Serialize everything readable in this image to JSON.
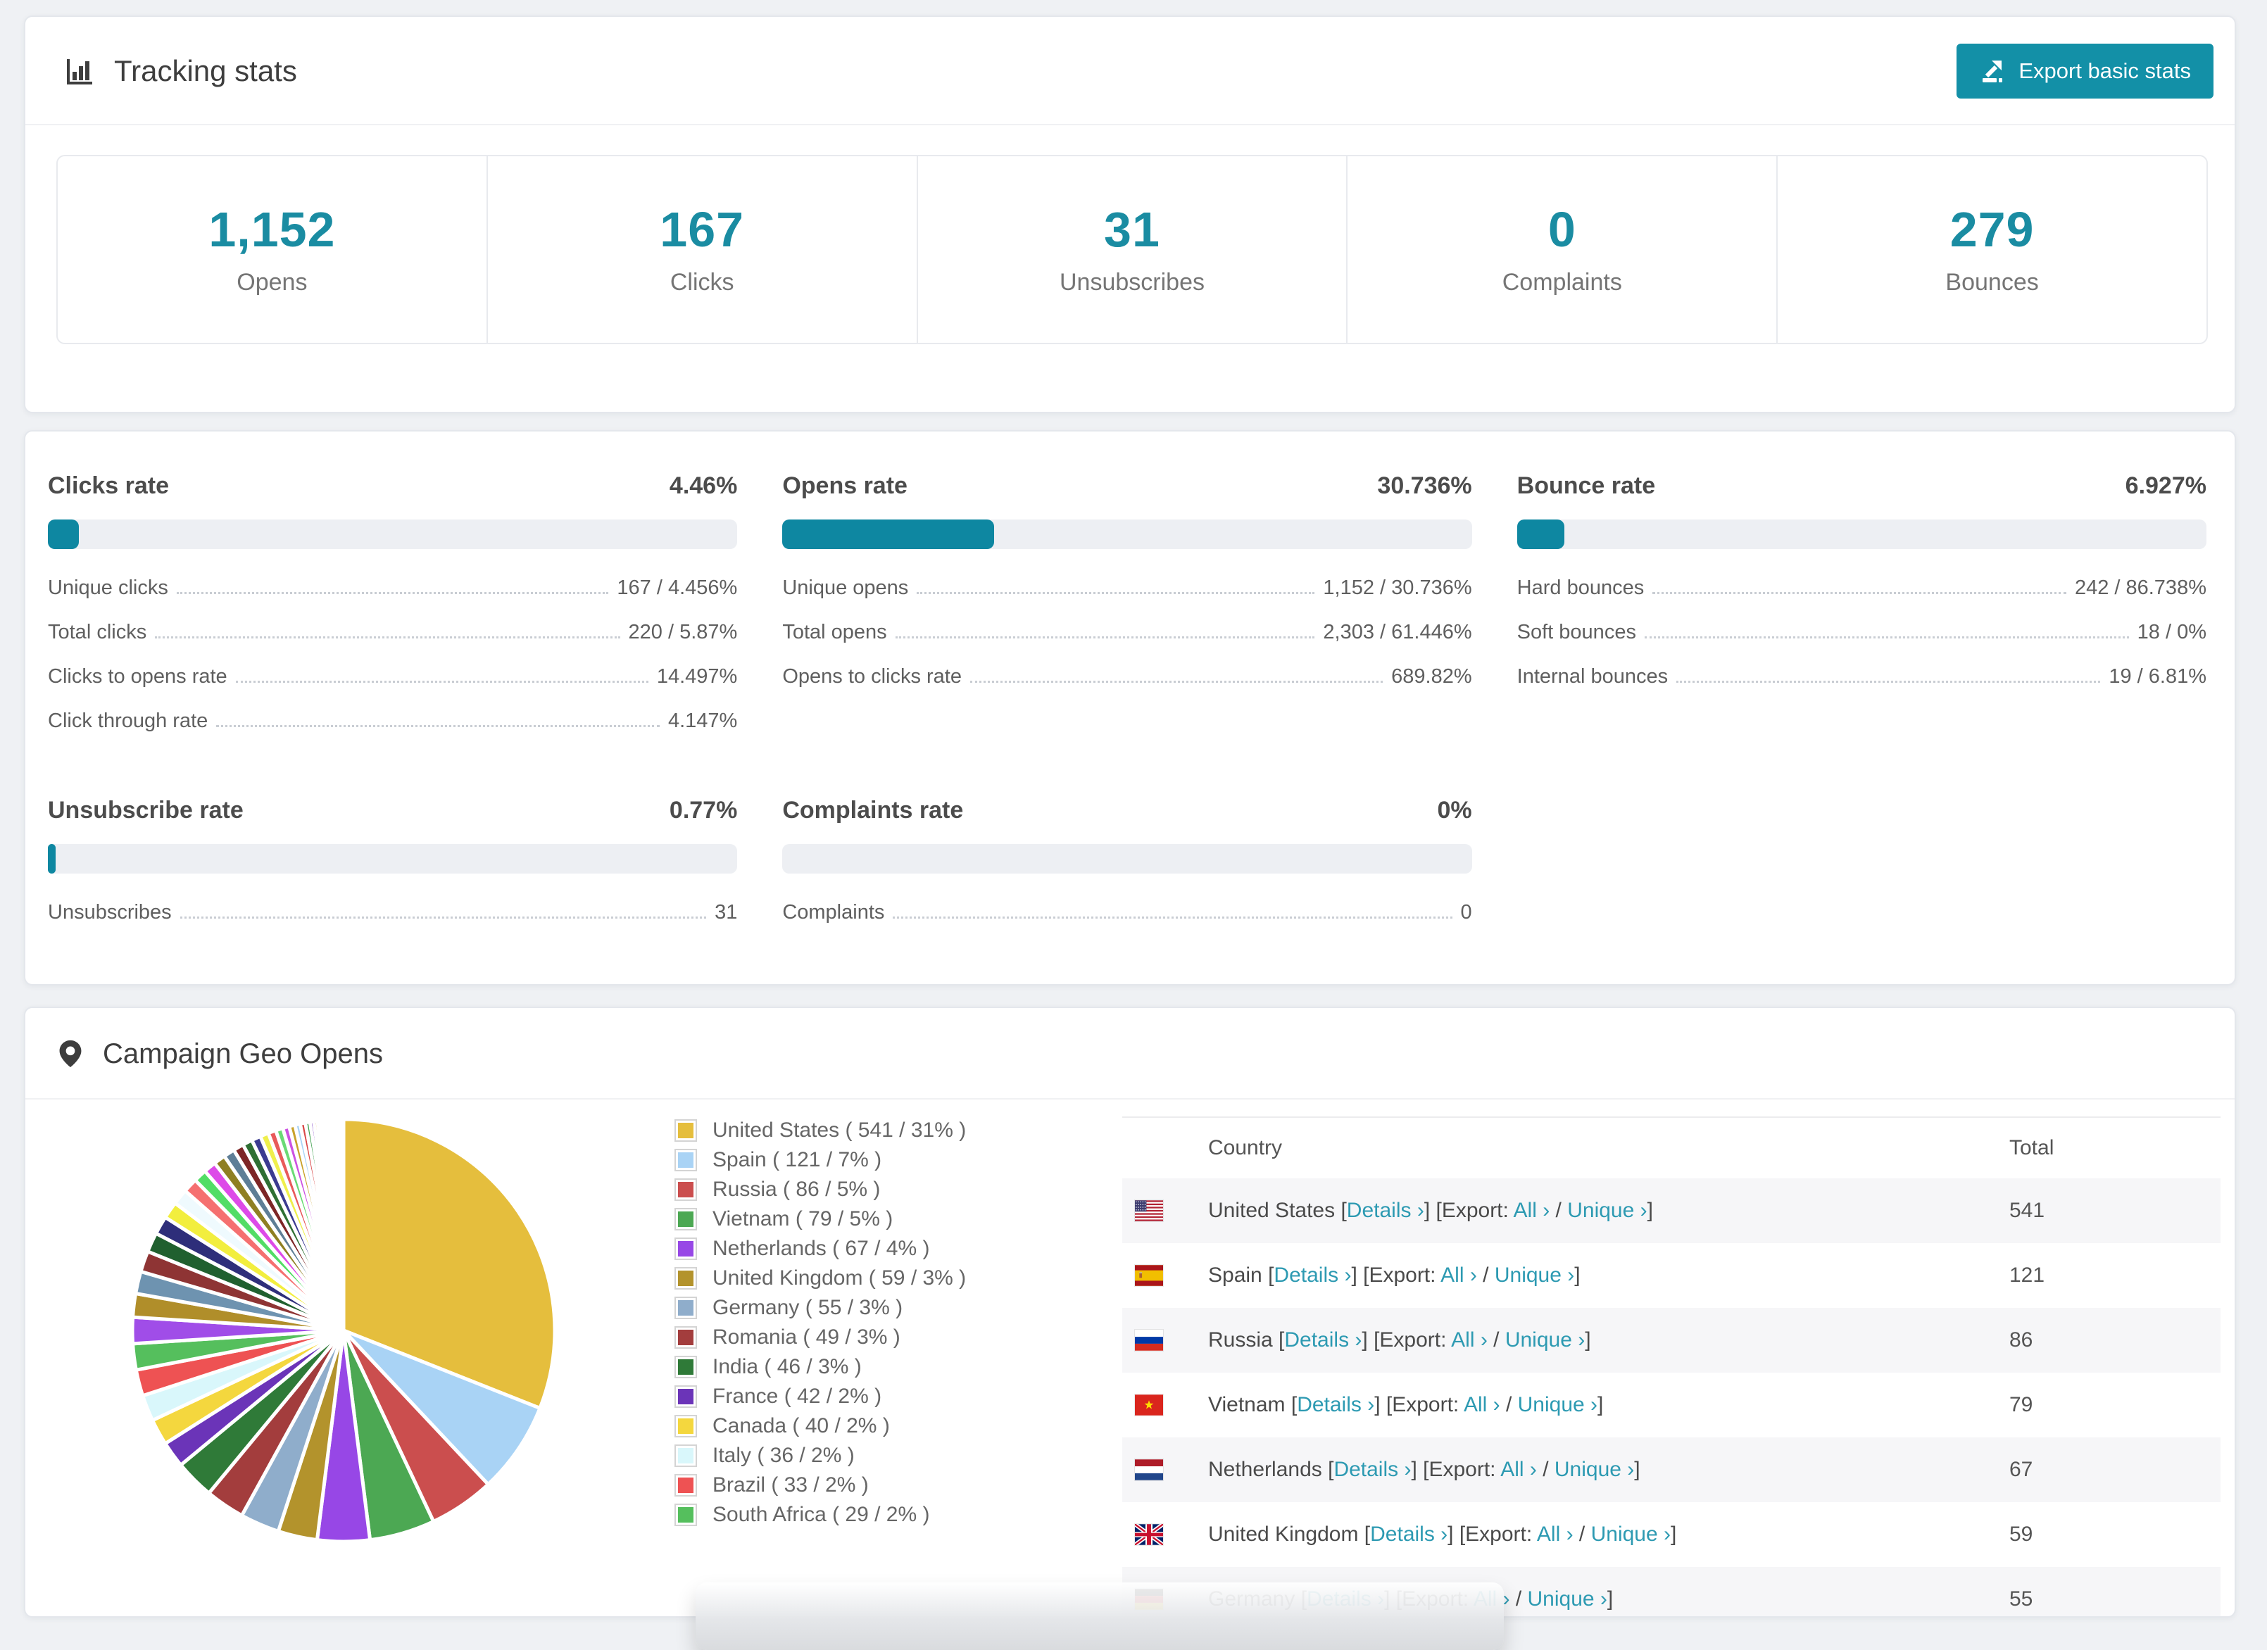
{
  "colors": {
    "accent_teal": "#1390A7",
    "bar_fill": "#0E87A1",
    "stat_number": "#1A8CA2",
    "link": "#2D9AB2",
    "page_background": "#EFF1F4"
  },
  "tracking": {
    "title": "Tracking stats",
    "export_button": "Export basic stats"
  },
  "summary_stats": [
    {
      "value": "1,152",
      "label": "Opens"
    },
    {
      "value": "167",
      "label": "Clicks"
    },
    {
      "value": "31",
      "label": "Unsubscribes"
    },
    {
      "value": "0",
      "label": "Complaints"
    },
    {
      "value": "279",
      "label": "Bounces"
    }
  ],
  "rate_blocks": [
    {
      "title": "Clicks rate",
      "value": "4.46%",
      "percent": 4.46,
      "rows": [
        {
          "label": "Unique clicks",
          "value": "167 / 4.456%"
        },
        {
          "label": "Total clicks",
          "value": "220 / 5.87%"
        },
        {
          "label": "Clicks to opens rate",
          "value": "14.497%"
        },
        {
          "label": "Click through rate",
          "value": "4.147%"
        }
      ]
    },
    {
      "title": "Opens rate",
      "value": "30.736%",
      "percent": 30.736,
      "rows": [
        {
          "label": "Unique opens",
          "value": "1,152 / 30.736%"
        },
        {
          "label": "Total opens",
          "value": "2,303 / 61.446%"
        },
        {
          "label": "Opens to clicks rate",
          "value": "689.82%"
        }
      ]
    },
    {
      "title": "Bounce rate",
      "value": "6.927%",
      "percent": 6.927,
      "rows": [
        {
          "label": "Hard bounces",
          "value": "242 / 86.738%"
        },
        {
          "label": "Soft bounces",
          "value": "18 / 0%"
        },
        {
          "label": "Internal bounces",
          "value": "19 / 6.81%"
        }
      ]
    },
    {
      "title": "Unsubscribe rate",
      "value": "0.77%",
      "percent": 0.77,
      "rows": [
        {
          "label": "Unsubscribes",
          "value": "31"
        }
      ]
    },
    {
      "title": "Complaints rate",
      "value": "0%",
      "percent": 0,
      "rows": [
        {
          "label": "Complaints",
          "value": "0"
        }
      ]
    }
  ],
  "geo": {
    "title": "Campaign Geo Opens",
    "table": {
      "col_country": "Country",
      "col_total": "Total",
      "details_label": "Details ›",
      "export_label": "Export:",
      "all_label": "All ›",
      "unique_label": "Unique ›",
      "bracket_open": "[",
      "bracket_close": "]",
      "slash": "/",
      "rows": [
        {
          "flag": "us",
          "country": "United States",
          "total": "541"
        },
        {
          "flag": "es",
          "country": "Spain",
          "total": "121"
        },
        {
          "flag": "ru",
          "country": "Russia",
          "total": "86"
        },
        {
          "flag": "vn",
          "country": "Vietnam",
          "total": "79"
        },
        {
          "flag": "nl",
          "country": "Netherlands",
          "total": "67"
        },
        {
          "flag": "gb",
          "country": "United Kingdom",
          "total": "59"
        },
        {
          "flag": "de",
          "country": "Germany",
          "total": "55"
        }
      ]
    }
  },
  "chart_data": {
    "type": "pie",
    "title": "Campaign Geo Opens",
    "unit": "opens",
    "legend_position": "right",
    "start_angle_deg": 0,
    "direction": "clockwise",
    "series": [
      {
        "name": "United States",
        "value": 541,
        "pct": 31,
        "color": "#E5BE3D"
      },
      {
        "name": "Spain",
        "value": 121,
        "pct": 7,
        "color": "#A9D3F5"
      },
      {
        "name": "Russia",
        "value": 86,
        "pct": 5,
        "color": "#CB4E4E"
      },
      {
        "name": "Vietnam",
        "value": 79,
        "pct": 5,
        "color": "#4CA853"
      },
      {
        "name": "Netherlands",
        "value": 67,
        "pct": 4,
        "color": "#9747E6"
      },
      {
        "name": "United Kingdom",
        "value": 59,
        "pct": 3,
        "color": "#B3932C"
      },
      {
        "name": "Germany",
        "value": 55,
        "pct": 3,
        "color": "#8FADCB"
      },
      {
        "name": "Romania",
        "value": 49,
        "pct": 3,
        "color": "#A33D3D"
      },
      {
        "name": "India",
        "value": 46,
        "pct": 3,
        "color": "#2F7A38"
      },
      {
        "name": "France",
        "value": 42,
        "pct": 2,
        "color": "#6B34B8"
      },
      {
        "name": "Canada",
        "value": 40,
        "pct": 2,
        "color": "#F4D73E"
      },
      {
        "name": "Italy",
        "value": 36,
        "pct": 2,
        "color": "#D9F7FB"
      },
      {
        "name": "Brazil",
        "value": 33,
        "pct": 2,
        "color": "#EE5253"
      },
      {
        "name": "South Africa",
        "value": 29,
        "pct": 2,
        "color": "#55BF5D"
      }
    ],
    "others": {
      "note": "unlabeled small countries completing the circle",
      "total_pct": 26,
      "values": [
        2.0,
        1.8,
        1.7,
        1.6,
        1.5,
        1.4,
        1.3,
        1.2,
        1.1,
        1.0,
        0.95,
        0.9,
        0.85,
        0.8,
        0.75,
        0.7,
        0.65,
        0.6,
        0.55,
        0.5,
        0.45,
        0.4,
        0.4,
        0.35,
        0.3,
        0.28,
        0.26,
        0.24,
        0.22,
        0.2,
        0.18,
        0.16,
        0.14,
        0.12,
        0.1,
        0.09,
        0.08,
        0.07,
        0.06,
        0.05
      ],
      "colors": [
        "#A04DE8",
        "#B08E2A",
        "#6E93B0",
        "#8E3434",
        "#20602F",
        "#2E2E7A",
        "#F2EE3E",
        "#EFFAFE",
        "#F57070",
        "#52DD66",
        "#DD4AE8",
        "#8F7F22",
        "#5E7E96",
        "#7D2626",
        "#2F6F33",
        "#3B3B90",
        "#EFEF4C",
        "#E85A5A",
        "#6ADA75",
        "#CC52E2",
        "#C9A22B",
        "#A9D3F5",
        "#D94848",
        "#41A04F",
        "#7E3EC4",
        "#E3BB3F",
        "#57C05F",
        "#EE5C66",
        "#9747E6",
        "#2F7A38",
        "#CB4E4E",
        "#A9D3F5",
        "#C9A22B",
        "#8FADCB",
        "#55BF5D",
        "#DD4AE8",
        "#6B34B8",
        "#EE5253",
        "#4CA853",
        "#E5BE3D"
      ]
    }
  }
}
